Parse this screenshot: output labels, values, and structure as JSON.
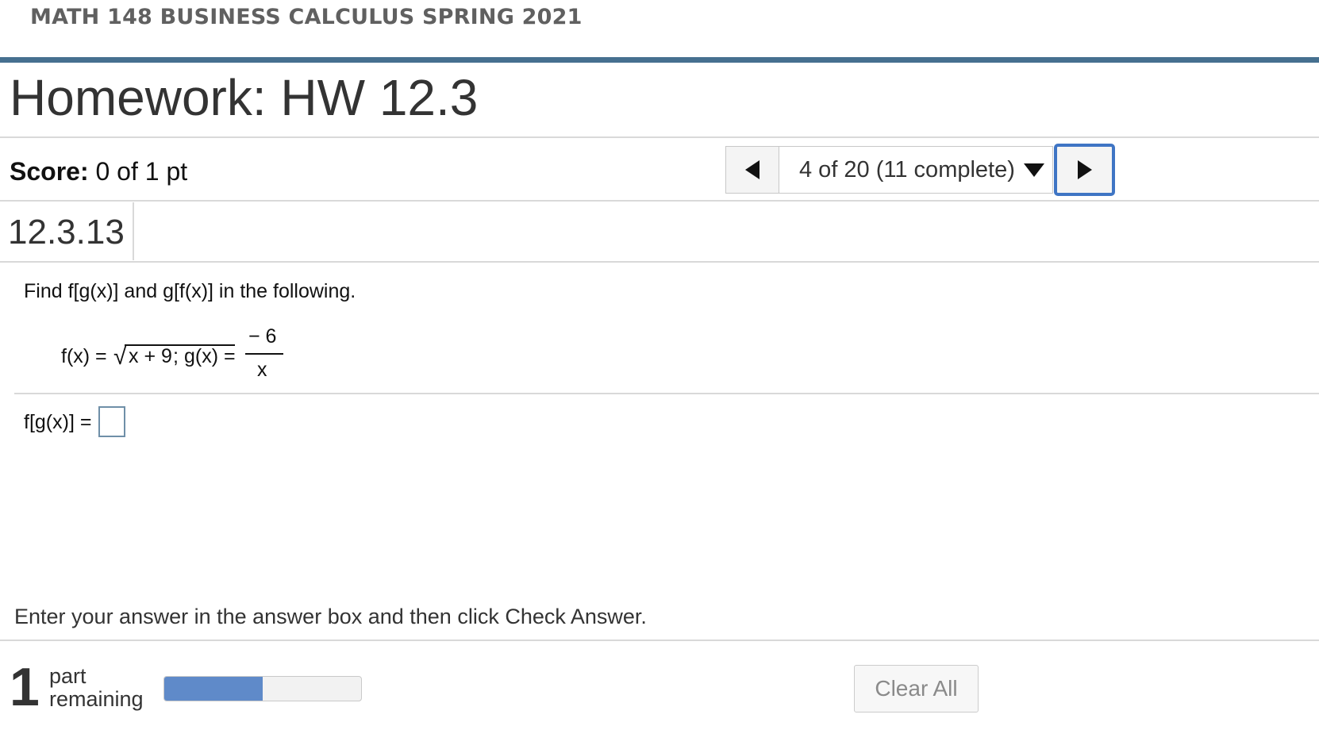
{
  "course": {
    "title": "MATH 148 BUSINESS CALCULUS SPRING 2021"
  },
  "homework": {
    "title": "Homework: HW 12.3"
  },
  "score": {
    "label": "Score:",
    "value": "0 of 1 pt"
  },
  "navigation": {
    "current": "4 of 20 (11 complete)",
    "prev_icon": "triangle-left-icon",
    "next_icon": "triangle-right-icon",
    "dropdown_icon": "caret-down-icon"
  },
  "question": {
    "id": "12.3.13",
    "prompt": "Find f[g(x)] and g[f(x)] in the following.",
    "math": {
      "f_label": "f(x) =",
      "radical": "√",
      "f_radicand": "x + 9",
      "separator": ";",
      "g_label": "g(x) =",
      "g_numerator": "− 6",
      "g_denominator": "x"
    },
    "answer_label": "f[g(x)] =",
    "answer_value": ""
  },
  "instruction": "Enter your answer in the answer box and then click Check Answer.",
  "footer": {
    "parts_count": "1",
    "parts_line1": "part",
    "parts_line2": "remaining",
    "progress": 0.5,
    "clear_all_label": "Clear All"
  },
  "colors": {
    "course_bar": "#467090",
    "progress_fill": "#5f8ac9",
    "next_button_border": "#3f75c4"
  }
}
